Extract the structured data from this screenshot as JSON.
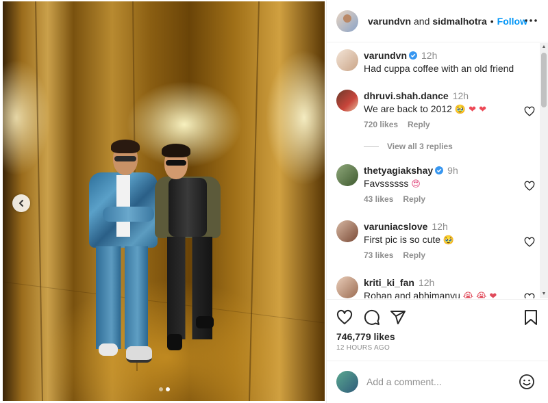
{
  "header": {
    "user1": "varundvn",
    "conjunction": "and",
    "user2": "sidmalhotra",
    "separator": "•",
    "follow_label": "Follow",
    "more_icon": "more-horizontal-icon"
  },
  "media": {
    "nav_prev_icon": "chevron-left-icon",
    "carousel_dots": 2,
    "active_dot": 2
  },
  "caption": {
    "user": "varundvn",
    "verified": true,
    "time": "12h",
    "text": "Had cuppa coffee with an old friend"
  },
  "comments": [
    {
      "user": "dhruvi.shah.dance",
      "verified": false,
      "time": "12h",
      "text": "We are back to 2012",
      "emojis": "🥹 ❤ ❤",
      "likes": "720 likes",
      "reply": "Reply",
      "view_replies": "View all 3 replies"
    },
    {
      "user": "thetyagiakshay",
      "verified": true,
      "time": "9h",
      "text": "Favssssss",
      "emojis": "😍",
      "likes": "43 likes",
      "reply": "Reply"
    },
    {
      "user": "varuniacslove",
      "verified": false,
      "time": "12h",
      "text": "First pic is so cute",
      "emojis": "🥹",
      "likes": "73 likes",
      "reply": "Reply"
    },
    {
      "user": "kriti_ki_fan",
      "verified": false,
      "time": "12h",
      "text": "Rohan and abhimanyu",
      "emojis": "😭 😭 ❤"
    }
  ],
  "actions": {
    "like_icon": "heart-icon",
    "comment_icon": "comment-icon",
    "share_icon": "share-icon",
    "save_icon": "bookmark-icon"
  },
  "likes_count": "746,779 likes",
  "post_time": "12 HOURS AGO",
  "add_comment": {
    "placeholder": "Add a comment...",
    "emoji_icon": "smiley-icon"
  },
  "colors": {
    "link_blue": "#0095f6",
    "verified_blue": "#3897f0",
    "heart_red": "#ed4956",
    "muted_text": "#8e8e8e"
  }
}
